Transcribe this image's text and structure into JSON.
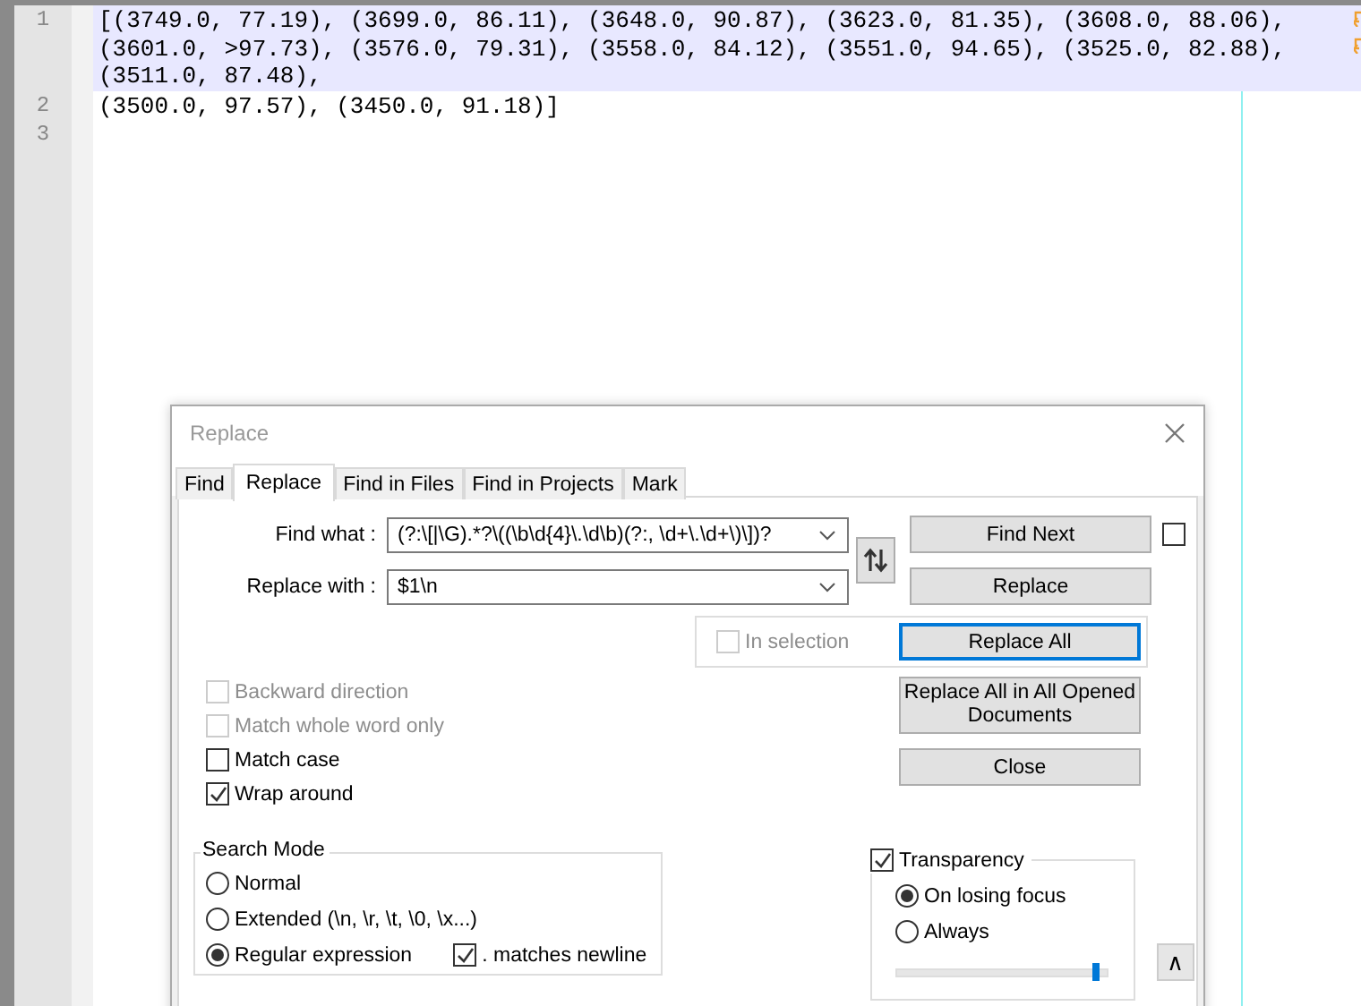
{
  "editor": {
    "lines": [
      {
        "number": "1",
        "highlighted": true,
        "segments": [
          "[(3749.0, 77.19), (3699.0, 86.11), (3648.0, 90.87), (3623.0, 81.35), (3608.0, 88.06),",
          "(3601.0, >97.73), (3576.0, 79.31), (3558.0, 84.12), (3551.0, 94.65), (3525.0, 82.88),",
          "(3511.0, 87.48),"
        ]
      },
      {
        "number": "2",
        "highlighted": false,
        "segments": [
          "(3500.0, 97.57), (3450.0, 91.18)]"
        ]
      },
      {
        "number": "3",
        "highlighted": false
      }
    ]
  },
  "dialog": {
    "title": "Replace",
    "tabs": [
      {
        "label": "Find",
        "selected": false
      },
      {
        "label": "Replace",
        "selected": true
      },
      {
        "label": "Find in Files",
        "selected": false
      },
      {
        "label": "Find in Projects",
        "selected": false
      },
      {
        "label": "Mark",
        "selected": false
      }
    ],
    "find_what": {
      "label": "Find what :",
      "value": "(?:\\[|\\G).*?\\((\\b\\d{4}\\.\\d\\b)(?:, \\d+\\.\\d+\\)\\])?"
    },
    "replace_with": {
      "label": "Replace with :",
      "value": "$1\\n"
    },
    "find_next": "Find Next",
    "replace": "Replace",
    "replace_all": "Replace All",
    "replace_all_opened": "Replace All in All Opened Documents",
    "close": "Close",
    "extra_checkbox": {
      "checked": false
    },
    "in_selection": {
      "label": "In selection",
      "checked": false,
      "disabled": true
    },
    "options": [
      {
        "label": "Backward direction",
        "checked": false,
        "disabled": true
      },
      {
        "label": "Match whole word only",
        "checked": false,
        "disabled": true
      },
      {
        "label": "Match case",
        "checked": false,
        "disabled": false
      },
      {
        "label": "Wrap around",
        "checked": true,
        "disabled": false
      }
    ],
    "search_mode": {
      "title": "Search Mode",
      "modes": [
        {
          "label": "Normal",
          "selected": false
        },
        {
          "label": "Extended (\\n, \\r, \\t, \\0, \\x...)",
          "selected": false
        },
        {
          "label": "Regular expression",
          "selected": true
        }
      ],
      "matches_newline": {
        "label": ". matches newline",
        "checked": true
      }
    },
    "transparency": {
      "label": "Transparency",
      "checked": true,
      "modes": [
        {
          "label": "On losing focus",
          "selected": true
        },
        {
          "label": "Always",
          "selected": false
        }
      ],
      "level": 0.97
    },
    "collapse": "∧"
  }
}
